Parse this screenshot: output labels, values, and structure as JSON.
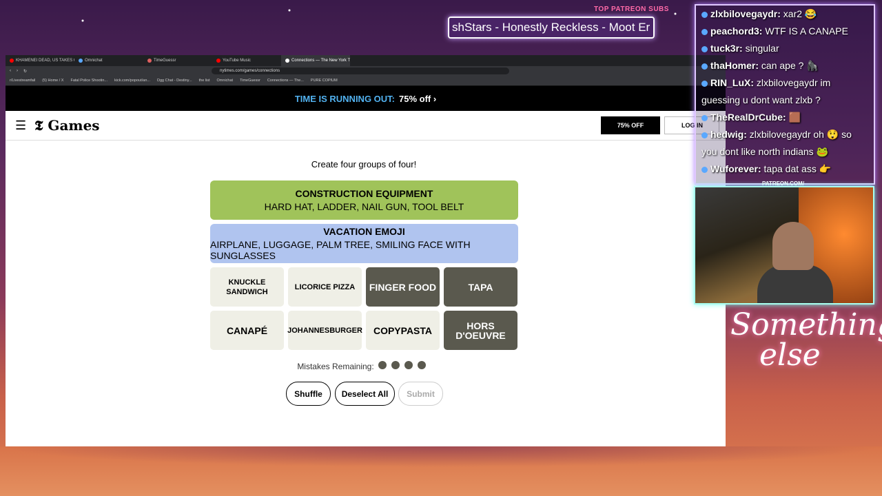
{
  "patreon": {
    "label": "TOP PATREON SUBS",
    "ticker": "shStars - Honestly Reckless - Moot Er"
  },
  "browser": {
    "tabs": [
      {
        "label": "KHAMENEI DEAD, US TAKES CASUA",
        "color": "#ff0000"
      },
      {
        "label": "Omnichat",
        "color": "#5aa8ff"
      },
      {
        "label": "TimeGuessr",
        "color": "#e06060"
      },
      {
        "label": "YouTube Music",
        "color": "#ff0000"
      },
      {
        "label": "Connections — The New York T",
        "color": "#ffffff"
      }
    ],
    "url": "nytimes.com/games/connections",
    "bookmarks": [
      "r/Livestreamfail",
      "(5) Home / X",
      "Fatal Police Shootin...",
      "kick.com/popout/an...",
      "Dgg Chat - Destiny...",
      "the list",
      "Omnichat",
      "TimeGuessr",
      "Connections — The...",
      "PURE COPIUM"
    ]
  },
  "promo": {
    "prefix": "TIME IS RUNNING OUT:",
    "offer": "75% off ›"
  },
  "header": {
    "menu_icon": "☰",
    "logo": "𝕿 Games",
    "subscribe": "75% OFF",
    "login": "LOG IN"
  },
  "game": {
    "instructions": "Create four groups of four!",
    "groups": [
      {
        "title": "CONSTRUCTION EQUIPMENT",
        "members": "HARD HAT, LADDER, NAIL GUN, TOOL BELT",
        "color": "#a0c35a"
      },
      {
        "title": "VACATION EMOJI",
        "members": "AIRPLANE, LUGGAGE, PALM TREE, SMILING FACE WITH SUNGLASSES",
        "color": "#b0c4ef"
      }
    ],
    "tiles": [
      {
        "label": "KNUCKLE SANDWICH",
        "selected": false
      },
      {
        "label": "LICORICE PIZZA",
        "selected": false
      },
      {
        "label": "FINGER FOOD",
        "selected": true
      },
      {
        "label": "TAPA",
        "selected": true
      },
      {
        "label": "CANAPÉ",
        "selected": false
      },
      {
        "label": "JOHANNESBURGER",
        "selected": false
      },
      {
        "label": "COPYPASTA",
        "selected": false
      },
      {
        "label": "HORS D'OEUVRE",
        "selected": true
      }
    ],
    "mistakes_label": "Mistakes Remaining:",
    "mistakes_remaining": 4,
    "buttons": {
      "shuffle": "Shuffle",
      "deselect": "Deselect All",
      "submit": "Submit"
    }
  },
  "chat": [
    {
      "user": "zlxbilovegaydr:",
      "text": " xar2 😂"
    },
    {
      "user": "peachord3:",
      "text": " WTF IS A CANAPE"
    },
    {
      "user": "tuck3r:",
      "text": " singular"
    },
    {
      "user": "thaHomer:",
      "text": " can ape ? 🦍"
    },
    {
      "user": "RIN_LuX:",
      "text": " zlxbilovegaydr im"
    },
    {
      "user": "",
      "text": "guessing u dont want zlxb ?"
    },
    {
      "user": "TheRealDrCube:",
      "text": " 🟫"
    },
    {
      "user": "hedwig:",
      "text": " zlxbilovegaydr oh 😲 so"
    },
    {
      "user": "",
      "text": "you dont like north indians 🐸"
    },
    {
      "user": "Wuforever:",
      "text": " tapa dat ass 👉"
    }
  ],
  "overlay": {
    "patreon_url": "PATREON.COM/",
    "signature": "Something else"
  }
}
